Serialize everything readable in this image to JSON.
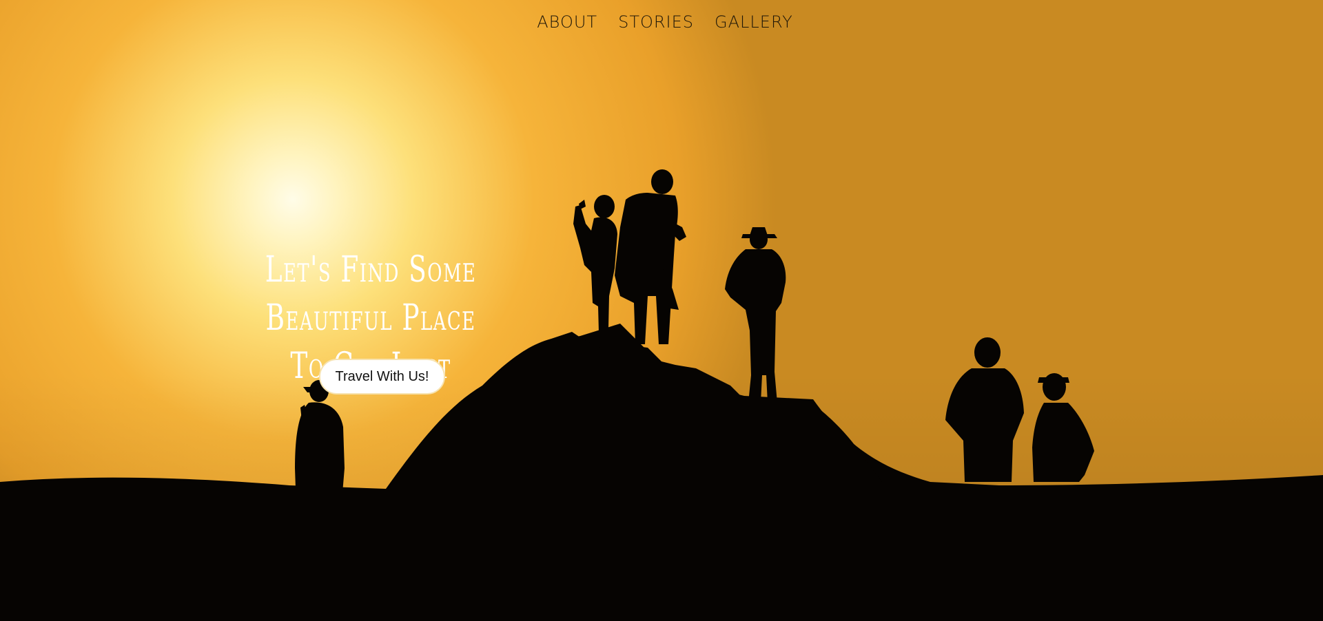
{
  "nav": {
    "items": [
      {
        "label": "ABOUT"
      },
      {
        "label": "STORIES"
      },
      {
        "label": "GALLERY"
      }
    ]
  },
  "hero": {
    "headline_line1": "Let's Find Some Beautiful Place",
    "headline_line2": "To Get Lost",
    "cta_label": "Travel With Us!"
  },
  "colors": {
    "sky_bright": "#fff3b0",
    "sky_orange": "#f0a830",
    "silhouette": "#060402",
    "cta_bg": "#ffffff"
  }
}
